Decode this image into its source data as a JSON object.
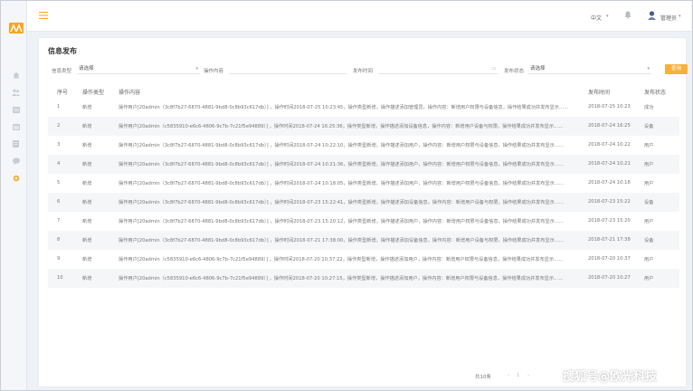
{
  "header": {
    "language": "中文",
    "user_name": "管理员"
  },
  "page": {
    "title": "信息发布"
  },
  "filters": {
    "type_label": "信息类型",
    "type_value": "请选择",
    "keyword_label": "操作内容",
    "date_label": "发布时间",
    "status_label": "发布状态",
    "status_value": "请选择",
    "query_button": "查询"
  },
  "table": {
    "columns": [
      "序号",
      "操作类型",
      "操作内容",
      "发布时间",
      "发布状态"
    ],
    "rows": [
      {
        "no": "1",
        "op": "新增",
        "content": "操作用户[20admin（3c8f7b27-6870-4881-9bd8-0c8b93c617db）] ，操作时间2018-07-25 10:23:45，操作类型新增，操作描述添加管理员，操作内容：新增用户权限与设备信息，操作结果成功并发布显示……",
        "time": "2018-07-25 10:23",
        "type": "成功"
      },
      {
        "no": "2",
        "op": "新增",
        "content": "操作用户[20admin（c5835910-e6c6-4806-9c7b-7c21f5e94889）] ，操作时间2018-07-24 16:25:36，操作类型新增，操作描述添加设备信息，操作内容：新增用户设备与权限，操作结果成功并发布显示……",
        "time": "2018-07-24 16:25",
        "type": "设备"
      },
      {
        "no": "3",
        "op": "新增",
        "content": "操作用户[20admin（3c8f7b27-6870-4881-9bd8-0c8b93c617db）] ，操作时间2018-07-24 10:22:10，操作类型新增，操作描述添加用户，操作内容：新增用户权限与设备信息，操作结果成功并发布显示……",
        "time": "2018-07-24 10:22",
        "type": "用户"
      },
      {
        "no": "4",
        "op": "新增",
        "content": "操作用户[20admin（3c8f7b27-6870-4881-9bd8-0c8b93c617db）] ，操作时间2018-07-24 10:21:36，操作类型新增，操作描述添加用户，操作内容：新增用户权限与设备信息，操作结果成功并发布显示……",
        "time": "2018-07-24 10:21",
        "type": "用户"
      },
      {
        "no": "5",
        "op": "新增",
        "content": "操作用户[20admin（3c8f7b27-6870-4881-9bd8-0c8b93c617db）] ，操作时间2018-07-24 10:18:05，操作类型新增，操作描述添加用户，操作内容：新增用户权限与设备信息，操作结果成功并发布显示……",
        "time": "2018-07-24 10:18",
        "type": "用户"
      },
      {
        "no": "6",
        "op": "新增",
        "content": "操作用户[20admin（3c8f7b27-6870-4881-9bd8-0c8b93c617db）] ，操作时间2018-07-23 15:22:41，操作类型新增，操作描述添加设备信息，操作内容：新增用户设备与权限，操作结果成功并发布显示……",
        "time": "2018-07-23 15:22",
        "type": "设备"
      },
      {
        "no": "7",
        "op": "新增",
        "content": "操作用户[20admin（3c8f7b27-6870-4881-9bd8-0c8b93c617db）] ，操作时间2018-07-23 15:20:12，操作类型新增，操作描述添加用户，操作内容：新增用户权限与设备信息，操作结果成功并发布显示……",
        "time": "2018-07-23 15:20",
        "type": "用户"
      },
      {
        "no": "8",
        "op": "新增",
        "content": "操作用户[20admin（3c8f7b27-6870-4881-9bd8-0c8b93c617db）] ，操作时间2018-07-21 17:38:00，操作类型新增，操作描述添加设备信息，操作内容：新增用户设备与权限，操作结果成功并发布显示……",
        "time": "2018-07-21 17:38",
        "type": "设备"
      },
      {
        "no": "9",
        "op": "新增",
        "content": "操作用户[20admin（c5835910-e6c6-4806-9c7b-7c21f5e94889）] ，操作时间2018-07-20 10:37:22，操作类型新增，操作描述添加用户，操作内容：新增用户权限与设备信息，操作结果成功并发布显示……",
        "time": "2018-07-20 10:37",
        "type": "用户"
      },
      {
        "no": "10",
        "op": "新增",
        "content": "操作用户[20admin（c5835910-e6c6-4806-9c7b-7c21f5e94889）] ，操作时间2018-07-20 10:27:15，操作类型新增，操作描述添加用户，操作内容：新增用户权限与设备信息，操作结果成功并发布显示……",
        "time": "2018-07-20 10:27",
        "type": "用户"
      }
    ]
  },
  "pagination": {
    "total_text": "共10条",
    "prev": "‹",
    "page": "1",
    "next": "›"
  },
  "watermark": "搜狐号@欧光科技",
  "colors": {
    "accent": "#f6b13b",
    "sidebar_bg": "#f4f6f9",
    "page_bg": "#eef1f6",
    "stripe": "#f5f6f8"
  },
  "icons": [
    "menu-toggle-icon",
    "home-icon",
    "users-icon",
    "list-icon",
    "calendar-icon",
    "document-icon",
    "chat-icon",
    "settings-icon",
    "bell-icon",
    "avatar-icon",
    "calendar-picker-icon"
  ]
}
